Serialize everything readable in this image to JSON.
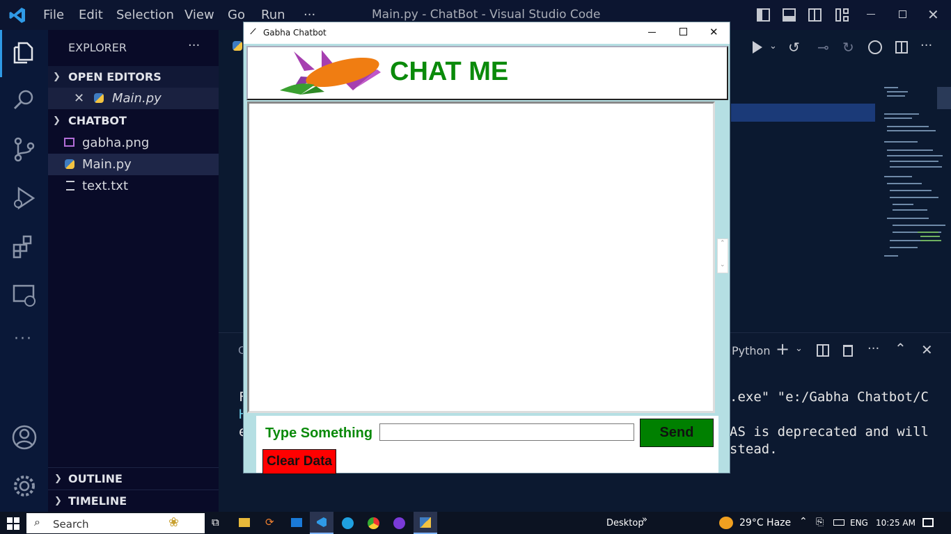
{
  "vscode": {
    "menu": [
      "File",
      "Edit",
      "Selection",
      "View",
      "Go",
      "Run",
      "···"
    ],
    "window_title": "Main.py - ChatBot - Visual Studio Code",
    "explorer": {
      "title": "EXPLORER",
      "more": "···",
      "open_editors": "OPEN EDITORS",
      "open_file": "Main.py",
      "project": "CHATBOT",
      "files": [
        "gabha.png",
        "Main.py",
        "text.txt"
      ],
      "outline": "OUTLINE",
      "timeline": "TIMELINE"
    },
    "panel": {
      "terminal_kind": "Python",
      "line1_prefix": "F",
      "line1_suffix": ".exe\" \"e:/Gabha Chatbot/C",
      "line2_prefix": "H",
      "line3_prefix": "e",
      "line3_suffix": "AS is deprecated and will",
      "line4_suffix": "stead.",
      "tab_prefix": "C"
    }
  },
  "chat": {
    "window_title": "Gabha Chatbot",
    "heading": "CHAT ME",
    "input_label": "Type Something",
    "input_value": "",
    "send_label": "Send",
    "clear_label": "Clear Data",
    "colors": {
      "heading": "#0a8a0a",
      "send": "#008000",
      "clear": "#ff0000",
      "frame": "#b5dfe3"
    }
  },
  "taskbar": {
    "search": "Search",
    "desktop": "Desktop",
    "weather": "29°C  Haze",
    "lang": "ENG",
    "time": "10:25 AM"
  }
}
